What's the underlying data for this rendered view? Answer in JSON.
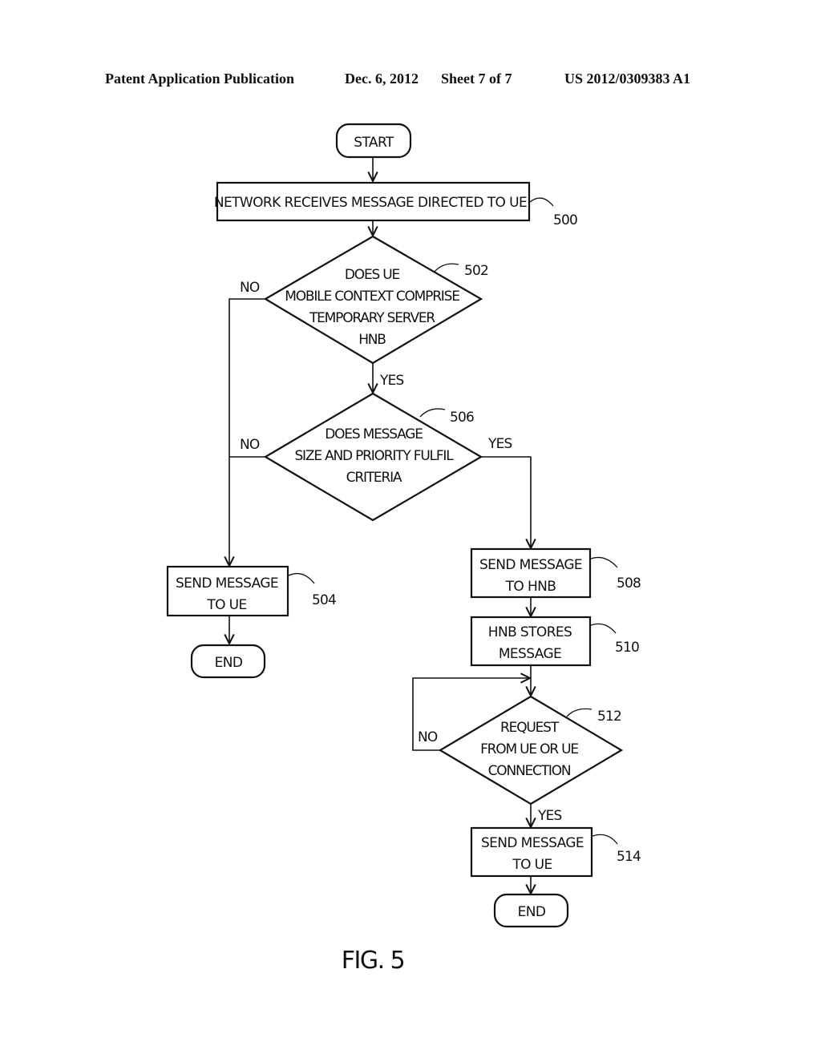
{
  "header": {
    "publication": "Patent Application Publication",
    "date": "Dec. 6, 2012",
    "sheet": "Sheet 7 of 7",
    "number": "US 2012/0309383 A1"
  },
  "figure_label": "FIG. 5",
  "nodes": {
    "start": {
      "type": "terminal",
      "lines": [
        "START"
      ]
    },
    "n500": {
      "type": "process",
      "ref": "500",
      "lines": [
        "NETWORK RECEIVES MESSAGE DIRECTED TO UE"
      ]
    },
    "n502": {
      "type": "decision",
      "ref": "502",
      "lines": [
        "DOES UE",
        "MOBILE CONTEXT COMPRISE",
        "TEMPORARY SERVER",
        "HNB"
      ]
    },
    "n506": {
      "type": "decision",
      "ref": "506",
      "lines": [
        "DOES MESSAGE",
        "SIZE AND PRIORITY FULFIL",
        "CRITERIA"
      ]
    },
    "n504": {
      "type": "process",
      "ref": "504",
      "lines": [
        "SEND MESSAGE",
        "TO UE"
      ]
    },
    "end_left": {
      "type": "terminal",
      "lines": [
        "END"
      ]
    },
    "n508": {
      "type": "process",
      "ref": "508",
      "lines": [
        "SEND MESSAGE",
        "TO HNB"
      ]
    },
    "n510": {
      "type": "process",
      "ref": "510",
      "lines": [
        "HNB STORES",
        "MESSAGE"
      ]
    },
    "n512": {
      "type": "decision",
      "ref": "512",
      "lines": [
        "REQUEST",
        "FROM UE OR UE",
        "CONNECTION"
      ]
    },
    "n514": {
      "type": "process",
      "ref": "514",
      "lines": [
        "SEND MESSAGE",
        "TO UE"
      ]
    },
    "end_right": {
      "type": "terminal",
      "lines": [
        "END"
      ]
    }
  },
  "edge_labels": {
    "n502_no": "NO",
    "n502_yes": "YES",
    "n506_no": "NO",
    "n506_yes": "YES",
    "n512_no": "NO",
    "n512_yes": "YES"
  },
  "edges": [
    {
      "from": "start",
      "to": "n500"
    },
    {
      "from": "n500",
      "to": "n502"
    },
    {
      "from": "n502",
      "to": "n506",
      "label": "YES"
    },
    {
      "from": "n502",
      "to": "n504",
      "label": "NO"
    },
    {
      "from": "n506",
      "to": "n504",
      "label": "NO"
    },
    {
      "from": "n506",
      "to": "n508",
      "label": "YES"
    },
    {
      "from": "n504",
      "to": "end_left"
    },
    {
      "from": "n508",
      "to": "n510"
    },
    {
      "from": "n510",
      "to": "n512"
    },
    {
      "from": "n512",
      "to": "n512",
      "label": "NO"
    },
    {
      "from": "n512",
      "to": "n514",
      "label": "YES"
    },
    {
      "from": "n514",
      "to": "end_right"
    }
  ]
}
